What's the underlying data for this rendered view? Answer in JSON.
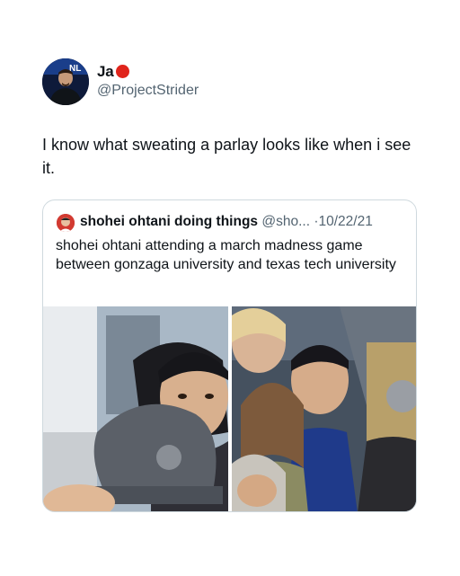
{
  "tweet": {
    "author": {
      "name": "Ja",
      "handle": "@ProjectStrider",
      "avatar_badge": "NL"
    },
    "text": "I know what sweating a parlay looks like when i see it."
  },
  "quoted": {
    "author": {
      "name": "shohei ohtani doing things",
      "handle": "@sho...",
      "separator": "·",
      "date": "10/22/21"
    },
    "text": "shohei ohtani attending a march madness game between gonzaga university and texas tech university",
    "media": [
      "photo-crowd-close",
      "photo-crowd-wide"
    ]
  },
  "colors": {
    "accent_dot": "#e0241b",
    "muted": "#536471",
    "border": "#cfd9de"
  }
}
